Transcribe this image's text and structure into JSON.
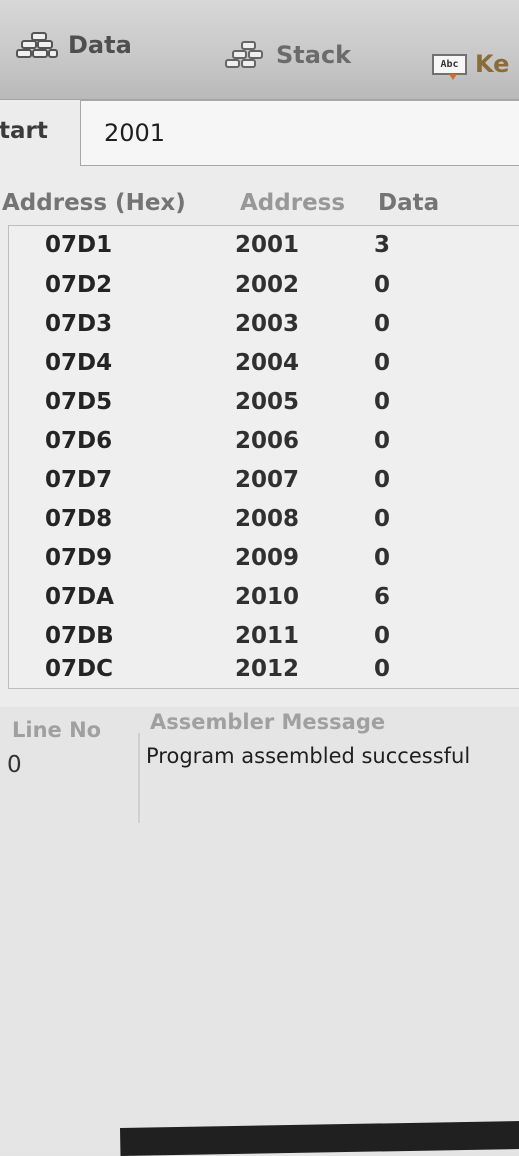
{
  "toolbar": {
    "items": [
      {
        "label": "Data",
        "icon": "data-icon"
      },
      {
        "label": "Stack",
        "icon": "stack-icon"
      },
      {
        "label": "Ke",
        "icon": "abc-keyboard-icon",
        "icon_text": "Abc"
      }
    ]
  },
  "start": {
    "label": "tart",
    "value": "2001"
  },
  "memory_table": {
    "headers": [
      "Address (Hex)",
      "Address",
      "Data"
    ],
    "rows": [
      {
        "hex": "07D1",
        "address": "2001",
        "data": "3"
      },
      {
        "hex": "07D2",
        "address": "2002",
        "data": "0"
      },
      {
        "hex": "07D3",
        "address": "2003",
        "data": "0"
      },
      {
        "hex": "07D4",
        "address": "2004",
        "data": "0"
      },
      {
        "hex": "07D5",
        "address": "2005",
        "data": "0"
      },
      {
        "hex": "07D6",
        "address": "2006",
        "data": "0"
      },
      {
        "hex": "07D7",
        "address": "2007",
        "data": "0"
      },
      {
        "hex": "07D8",
        "address": "2008",
        "data": "0"
      },
      {
        "hex": "07D9",
        "address": "2009",
        "data": "0"
      },
      {
        "hex": "07DA",
        "address": "2010",
        "data": "6"
      },
      {
        "hex": "07DB",
        "address": "2011",
        "data": "0"
      },
      {
        "hex": "07DC",
        "address": "2012",
        "data": "0"
      }
    ]
  },
  "assembler": {
    "headers": [
      "Line No",
      "Assembler Message"
    ],
    "line_no": "0",
    "message": "Program assembled successful"
  },
  "colors": {
    "toolbar_bg": "#cfcfcf",
    "table_bg": "#efefef",
    "text": "#1d1d1d",
    "accent_orange": "#d96a24"
  }
}
